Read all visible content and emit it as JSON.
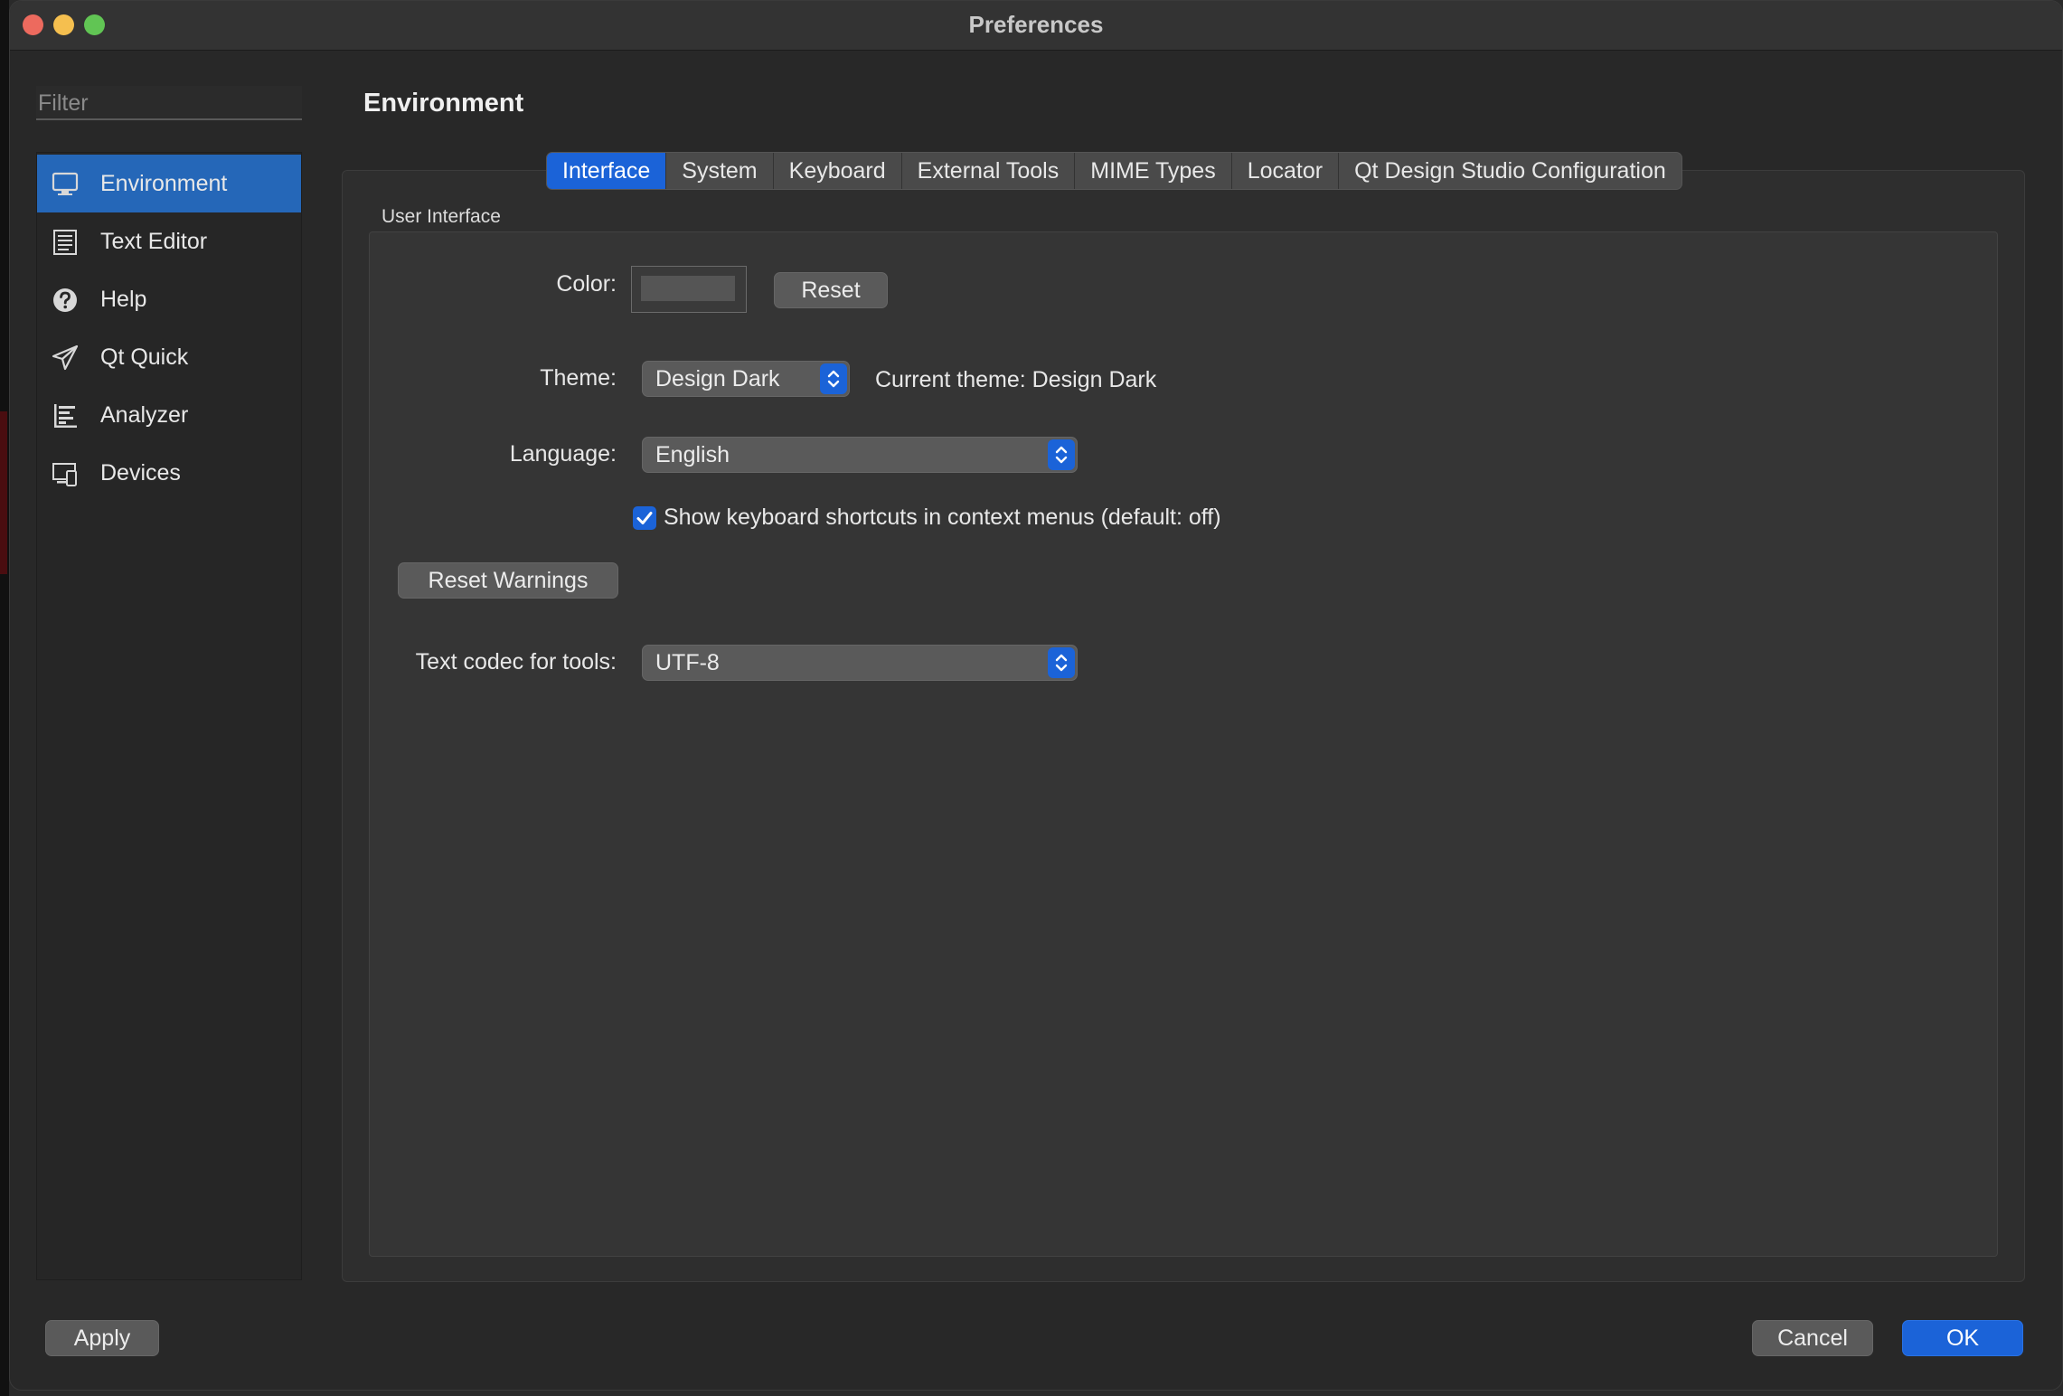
{
  "window": {
    "title": "Preferences"
  },
  "sidebar": {
    "filter_placeholder": "Filter",
    "items": [
      {
        "label": "Environment",
        "icon": "monitor-icon",
        "active": true
      },
      {
        "label": "Text Editor",
        "icon": "document-icon",
        "active": false
      },
      {
        "label": "Help",
        "icon": "help-icon",
        "active": false
      },
      {
        "label": "Qt Quick",
        "icon": "paper-plane-icon",
        "active": false
      },
      {
        "label": "Analyzer",
        "icon": "analyzer-icon",
        "active": false
      },
      {
        "label": "Devices",
        "icon": "devices-icon",
        "active": false
      }
    ]
  },
  "main": {
    "section_title": "Environment",
    "tabs": [
      {
        "label": "Interface",
        "active": true
      },
      {
        "label": "System",
        "active": false
      },
      {
        "label": "Keyboard",
        "active": false
      },
      {
        "label": "External Tools",
        "active": false
      },
      {
        "label": "MIME Types",
        "active": false
      },
      {
        "label": "Locator",
        "active": false
      },
      {
        "label": "Qt Design Studio Configuration",
        "active": false
      }
    ],
    "group_label": "User Interface",
    "color_label": "Color:",
    "color_value": "#555555",
    "reset_label": "Reset",
    "theme_label": "Theme:",
    "theme_value": "Design Dark",
    "current_theme": "Current theme: Design Dark",
    "language_label": "Language:",
    "language_value": "English",
    "shortcuts_checkbox_label": "Show keyboard shortcuts in context menus (default: off)",
    "shortcuts_checked": true,
    "reset_warnings_label": "Reset Warnings",
    "codec_label": "Text codec for tools:",
    "codec_value": "UTF-8"
  },
  "footer": {
    "apply_label": "Apply",
    "cancel_label": "Cancel",
    "ok_label": "OK"
  },
  "colors": {
    "accent": "#1b63d8",
    "sidebar_active": "#2567b8",
    "background": "#282828"
  }
}
